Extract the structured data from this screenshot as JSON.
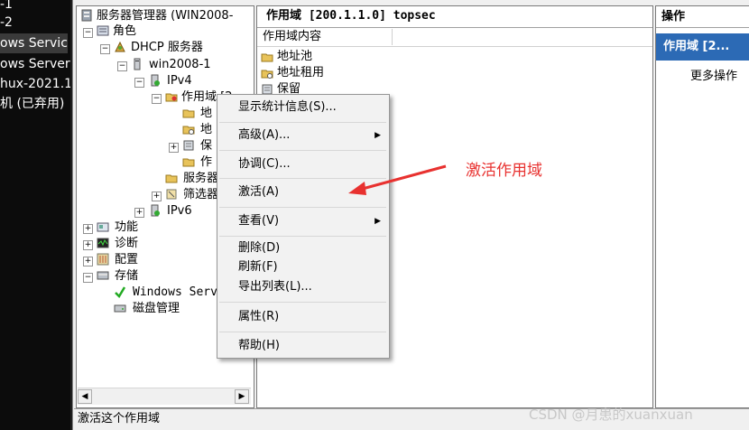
{
  "vm_list": [
    "-1",
    "-2",
    "ows Servic",
    "ows Server",
    "hux-2021.1",
    "机 (已弃用)"
  ],
  "tree": {
    "root": "服务器管理器 (WIN2008-",
    "roles": "角色",
    "dhcp": "DHCP 服务器",
    "server": "win2008-1",
    "ipv4": "IPv4",
    "scope": "作用域 [2",
    "addr_pool_short": "地",
    "addr_lease_short": "地",
    "reserve_short": "保",
    "scope_opts_short": "作",
    "server_opts": "服务器",
    "filters": "筛选器",
    "ipv6": "IPv6",
    "features": "功能",
    "diagnostics": "诊断",
    "config": "配置",
    "storage": "存储",
    "wsb": "Windows Serv",
    "disk_mgmt": "磁盘管理"
  },
  "list": {
    "title": "作用域 [200.1.1.0] topsec",
    "column": "作用域内容",
    "items": [
      "地址池",
      "地址租用",
      "保留"
    ]
  },
  "actions": {
    "title": "操作",
    "scope": "作用域 [2...",
    "more": "更多操作"
  },
  "context_menu": {
    "stats": "显示统计信息(S)...",
    "advanced": "高级(A)...",
    "reconcile": "协调(C)...",
    "activate": "激活(A)",
    "view": "查看(V)",
    "delete": "删除(D)",
    "refresh": "刷新(F)",
    "export": "导出列表(L)...",
    "properties": "属性(R)",
    "help": "帮助(H)"
  },
  "annotation": "激活作用域",
  "status_text": "激活这个作用域",
  "watermark": "CSDN @月患的xuanxuan",
  "colors": {
    "accent": "#2c6ab5",
    "annotation": "#e8312f"
  }
}
